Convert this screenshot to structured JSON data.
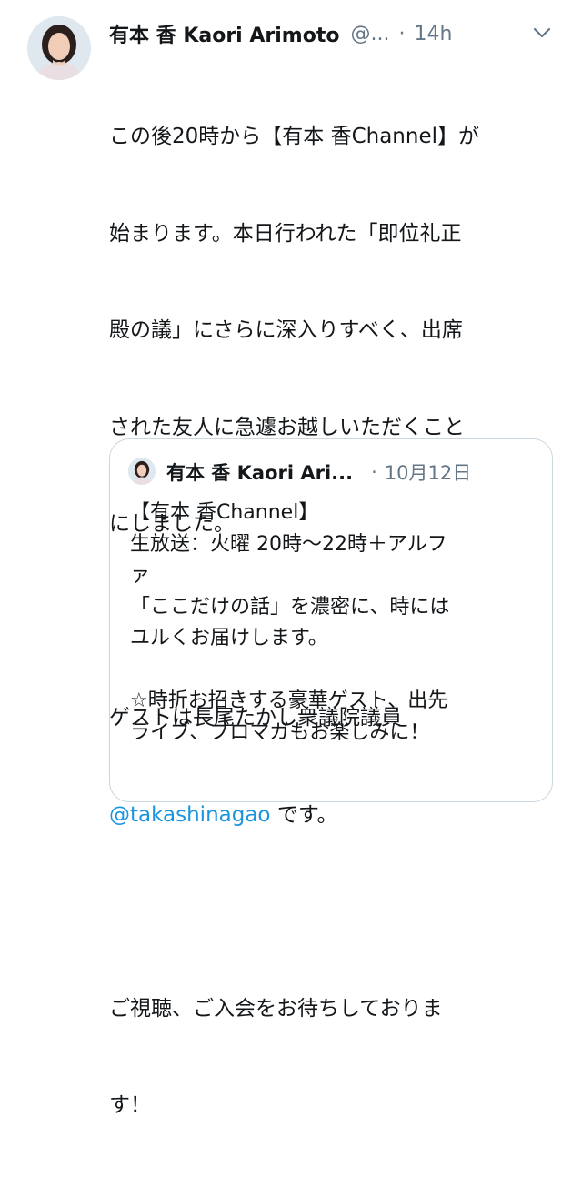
{
  "tweet": {
    "author_name": "有本 香 Kaori Arimoto",
    "author_handle": "@...",
    "separator": "·",
    "time": "14h",
    "avatar_icon": "profile-photo",
    "menu_icon": "chevron-down-icon",
    "body": {
      "line1": "この後20時から【有本 香Channel】が",
      "line2": "始まります。本日行われた「即位礼正",
      "line3": "殿の議」にさらに深入りすべく、出席",
      "line4": "された友人に急遽お越しいただくこと",
      "line5": "にしました。",
      "line6": "ゲストは長尾たかし衆議院議員",
      "mention": "@takashinagao",
      "after_mention": " です。",
      "line8": "ご視聴、ご入会をお待ちしておりま",
      "line9": "す！"
    }
  },
  "quoted": {
    "author_name": "有本 香 Kaori Ari...",
    "separator": "·",
    "date": "10月12日",
    "lines": [
      "【有本 香Channel】",
      "生放送：火曜 20時〜22時＋アルフ",
      "ァ",
      "「ここだけの話」を濃密に、時には",
      "ユルくお届けします。",
      "",
      "☆時折お招きする豪華ゲスト、出先",
      "ライブ、ブロマガもお楽しみに！"
    ]
  },
  "colors": {
    "link": "#1b95e0",
    "secondary_text": "#657786",
    "border": "#ccd6dd"
  }
}
